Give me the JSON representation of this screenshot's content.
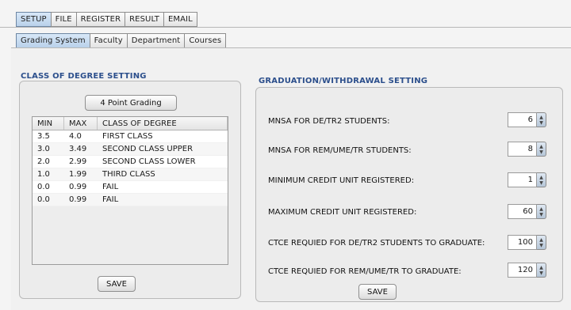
{
  "top_tabs": [
    "SETUP",
    "FILE",
    "REGISTER",
    "RESULT",
    "EMAIL"
  ],
  "sub_tabs": [
    "Grading System",
    "Faculty",
    "Department",
    "Courses"
  ],
  "class_section": {
    "title": "CLASS OF DEGREE SETTING",
    "grading_button": "4 Point Grading",
    "columns": [
      "MIN",
      "MAX",
      "CLASS OF DEGREE"
    ],
    "rows": [
      [
        "3.5",
        "4.0",
        "FIRST CLASS"
      ],
      [
        "3.0",
        "3.49",
        "SECOND CLASS UPPER"
      ],
      [
        "2.0",
        "2.99",
        "SECOND CLASS LOWER"
      ],
      [
        "1.0",
        "1.99",
        "THIRD CLASS"
      ],
      [
        "0.0",
        "0.99",
        "FAIL"
      ],
      [
        "0.0",
        "0.99",
        "FAIL"
      ]
    ],
    "save": "SAVE"
  },
  "grad_section": {
    "title": "GRADUATION/WITHDRAWAL SETTING",
    "settings": [
      {
        "label": "MNSA FOR DE/TR2 STUDENTS:",
        "value": "6"
      },
      {
        "label": "MNSA FOR REM/UME/TR STUDENTS:",
        "value": "8"
      },
      {
        "label": "MINIMUM CREDIT UNIT REGISTERED:",
        "value": "1"
      },
      {
        "label": "MAXIMUM CREDIT UNIT REGISTERED:",
        "value": "60"
      },
      {
        "label": "CTCE REQUIED FOR DE/TR2 STUDENTS TO GRADUATE:",
        "value": "100"
      },
      {
        "label": "CTCE REQUIED FOR REM/UME/TR TO GRADUATE:",
        "value": "120"
      }
    ],
    "save": "SAVE"
  }
}
